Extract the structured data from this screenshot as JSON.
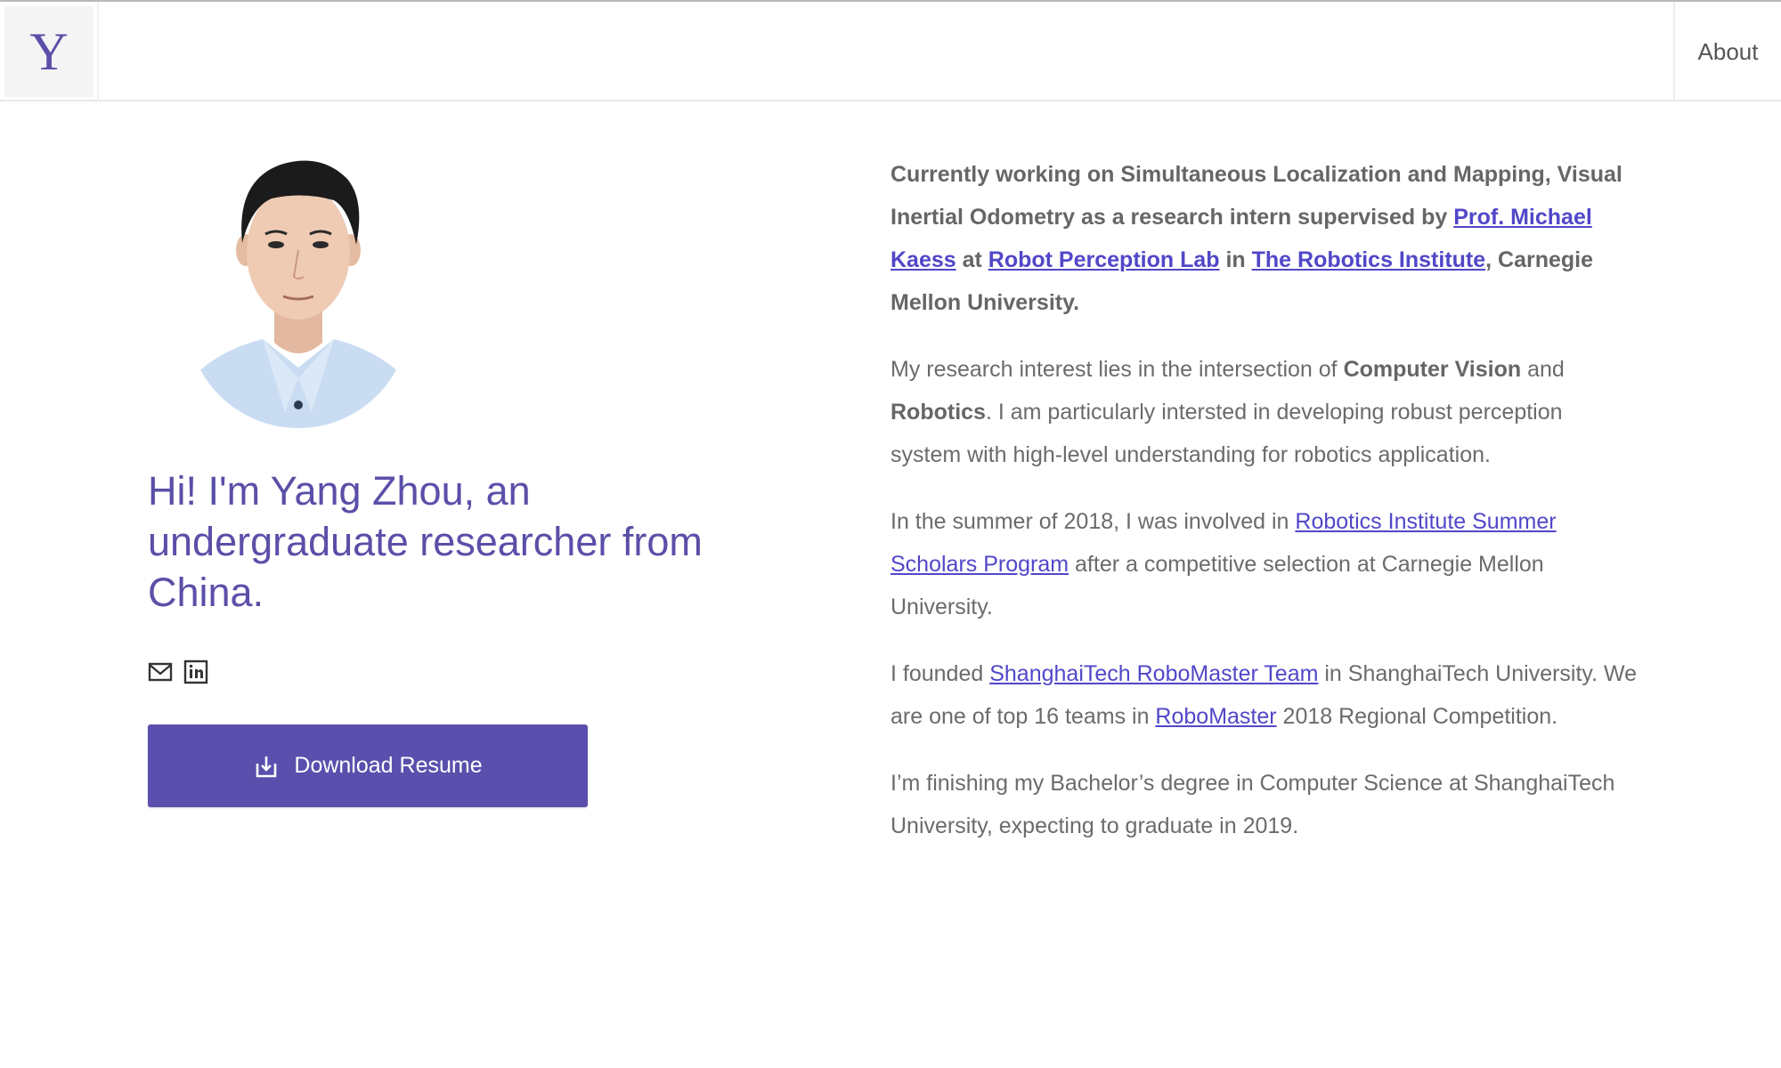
{
  "header": {
    "logo_letter": "Y",
    "nav": {
      "about": "About"
    }
  },
  "profile": {
    "intro": "Hi! I'm Yang Zhou, an undergraduate researcher from China.",
    "resume_button": "Download Resume"
  },
  "bio": {
    "p1": {
      "t1": "Currently working on Simultaneous Localization and Mapping, Visual Inertial Odometry as a research intern supervised by ",
      "link_prof": "Prof. Michael Kaess",
      "t2": " at ",
      "link_lab": "Robot Perception Lab",
      "t3": " in ",
      "link_ri": "The Robotics Institute",
      "t4": ", Carnegie Mellon University."
    },
    "p2": {
      "t1": "My research interest lies in the intersection of ",
      "b1": "Computer Vision",
      "t2": " and ",
      "b2": "Robotics",
      "t3": ". I am particularly intersted in developing robust perception system with high-level understanding for robotics application."
    },
    "p3": {
      "t1": "In the summer of 2018, I was involved in ",
      "link_riss": "Robotics Institute Summer Scholars Program",
      "t2": " after a competitive selection at Carnegie Mellon University."
    },
    "p4": {
      "t1": "I founded ",
      "link_team": "ShanghaiTech RoboMaster Team",
      "t2": " in ShanghaiTech University. We are one of top 16 teams in ",
      "link_robomaster": "RoboMaster",
      "t3": " 2018 Regional Competition."
    },
    "p5": {
      "t1": "I’m finishing my Bachelor’s degree in Computer Science at ShanghaiTech University, expecting to graduate in 2019."
    }
  },
  "icons": {
    "email": "mail-icon",
    "linkedin": "linkedin-icon",
    "download": "download-icon"
  },
  "colors": {
    "accent": "#5a4fa8",
    "link": "#5147c8",
    "text": "#6b6b6b",
    "button": "#5a4fad"
  }
}
